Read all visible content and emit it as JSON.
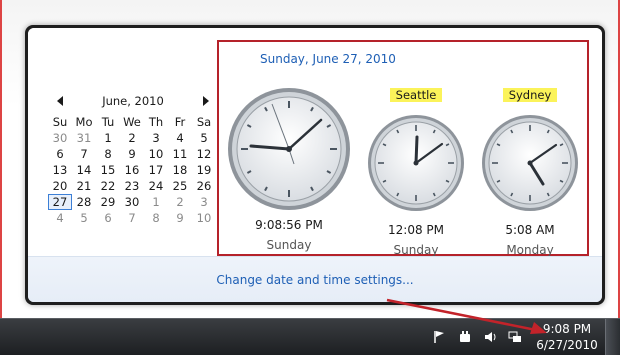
{
  "calendar": {
    "month_label": "June, 2010",
    "weekdays": [
      "Su",
      "Mo",
      "Tu",
      "We",
      "Th",
      "Fr",
      "Sa"
    ],
    "weeks": [
      [
        "30",
        "31",
        "1",
        "2",
        "3",
        "4",
        "5"
      ],
      [
        "6",
        "7",
        "8",
        "9",
        "10",
        "11",
        "12"
      ],
      [
        "13",
        "14",
        "15",
        "16",
        "17",
        "18",
        "19"
      ],
      [
        "20",
        "21",
        "22",
        "23",
        "24",
        "25",
        "26"
      ],
      [
        "27",
        "28",
        "29",
        "30",
        "1",
        "2",
        "3"
      ],
      [
        "4",
        "5",
        "6",
        "7",
        "8",
        "9",
        "10"
      ]
    ]
  },
  "clocks": {
    "date_line": "Sunday, June 27, 2010",
    "main": {
      "time": "9:08:56 PM",
      "day": "Sunday"
    },
    "seattle": {
      "label": "Seattle",
      "time": "12:08 PM",
      "day": "Sunday"
    },
    "sydney": {
      "label": "Sydney",
      "time": "5:08 AM",
      "day": "Monday"
    }
  },
  "footer": {
    "change_link": "Change date and time settings..."
  },
  "taskbar": {
    "time": "9:08 PM",
    "date": "6/27/2010"
  },
  "colors": {
    "highlight": "#b5222a",
    "label_bg": "#fbf35a",
    "link": "#1e5fb5"
  }
}
